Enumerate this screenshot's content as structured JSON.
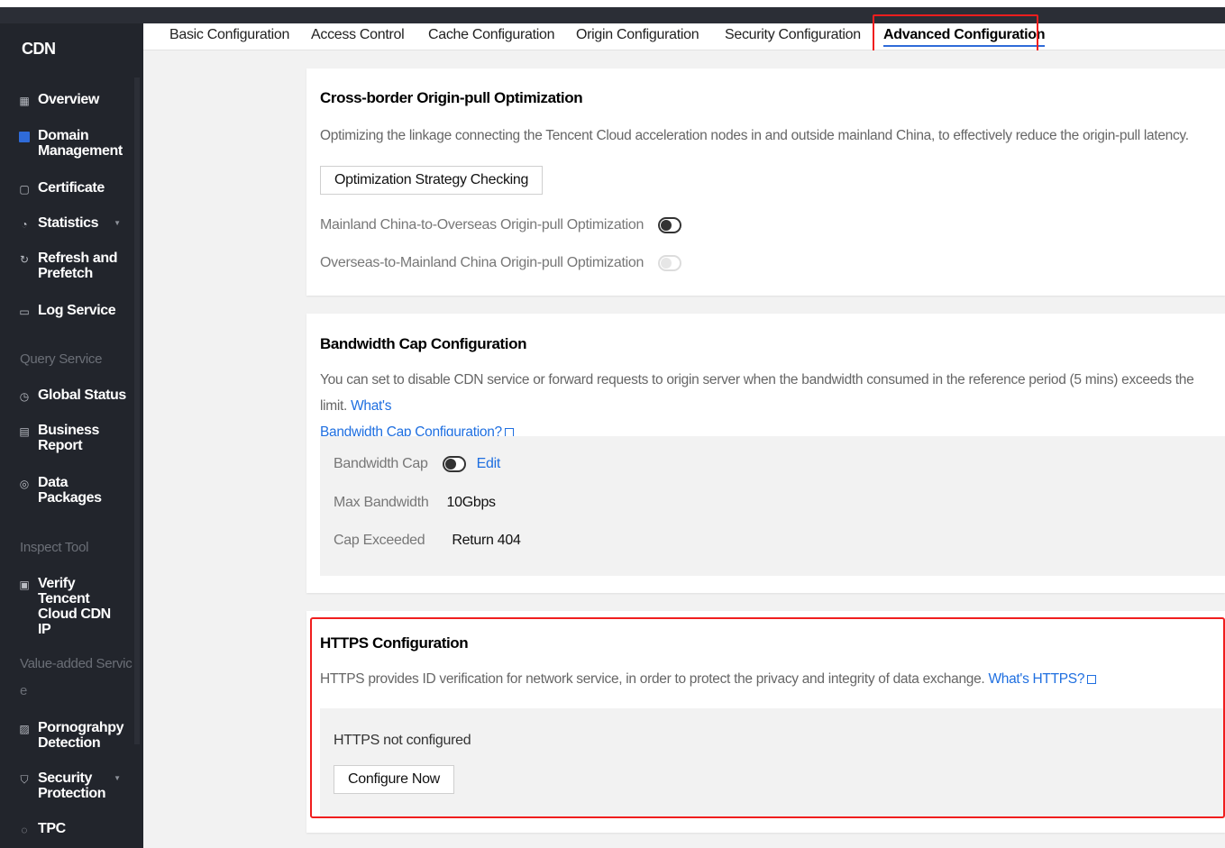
{
  "sidebar": {
    "brand": "CDN",
    "items": [
      {
        "label": "Overview",
        "icon": "grid-icon"
      },
      {
        "label": "Domain Management",
        "icon": "domain-icon"
      },
      {
        "label": "Certificate",
        "icon": "certificate-icon"
      },
      {
        "label": "Statistics",
        "icon": "statistics-icon"
      },
      {
        "label": "Refresh and Prefetch",
        "icon": "refresh-icon"
      },
      {
        "label": "Log Service",
        "icon": "log-icon"
      },
      {
        "label": "Global Status",
        "icon": "clock-icon"
      },
      {
        "label": "Business Report",
        "icon": "report-icon"
      },
      {
        "label": "Data Packages",
        "icon": "package-icon"
      },
      {
        "label": "Verify Tencent Cloud CDN IP",
        "icon": "verify-icon"
      },
      {
        "label": "Pornograhpy Detection",
        "icon": "image-icon"
      },
      {
        "label": "Security Protection",
        "icon": "shield-icon"
      },
      {
        "label": "TPC",
        "icon": "tpc-icon"
      }
    ],
    "sections": {
      "query": "Query Service",
      "inspect": "Inspect Tool",
      "value_added_line1": "Value-added Servic",
      "value_added_line2": "e"
    }
  },
  "tabs": [
    "Basic Configuration",
    "Access Control",
    "Cache Configuration",
    "Origin Configuration",
    "Security Configuration",
    "Advanced Configuration"
  ],
  "cross_border": {
    "title": "Cross-border Origin-pull Optimization",
    "description": "Optimizing the linkage connecting the Tencent Cloud acceleration nodes in and outside mainland China, to effectively reduce the origin-pull latency.",
    "button": "Optimization Strategy Checking",
    "option1": "Mainland China-to-Overseas Origin-pull Optimization",
    "option2": "Overseas-to-Mainland China Origin-pull Optimization"
  },
  "bandwidth": {
    "title": "Bandwidth Cap Configuration",
    "description": "You can set to disable CDN service or forward requests to origin server when the bandwidth consumed in the reference period (5 mins) exceeds the limit.",
    "link_part1": "What's",
    "link_part2": "Bandwidth Cap Configuration?",
    "cap_label": "Bandwidth Cap",
    "edit": "Edit",
    "max_label": "Max Bandwidth",
    "max_value": "10Gbps",
    "exceeded_label": "Cap Exceeded",
    "exceeded_value": "Return 404"
  },
  "https": {
    "title": "HTTPS Configuration",
    "description": "HTTPS provides ID verification for network service, in order to protect the privacy and integrity of data exchange.",
    "link": "What's HTTPS?",
    "status": "HTTPS not configured",
    "button": "Configure Now"
  }
}
